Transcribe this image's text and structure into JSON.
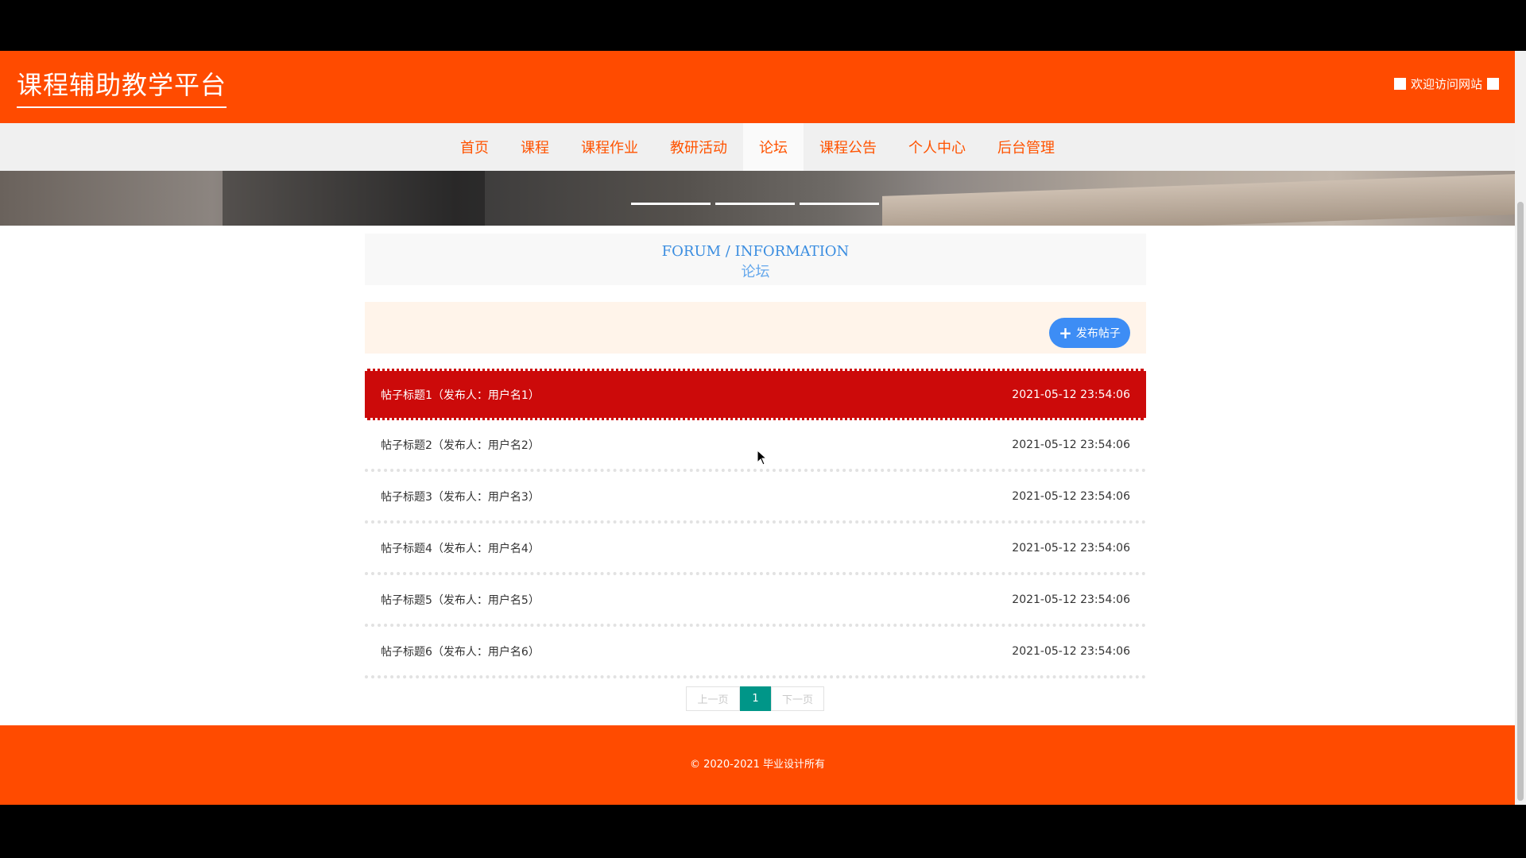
{
  "header": {
    "site_title": "课程辅助教学平台",
    "welcome_text": "欢迎访问网站",
    "brand_color": "#ff4b00"
  },
  "nav": {
    "items": [
      {
        "label": "首页"
      },
      {
        "label": "课程"
      },
      {
        "label": "课程作业"
      },
      {
        "label": "教研活动"
      },
      {
        "label": "论坛",
        "active": true
      },
      {
        "label": "课程公告"
      },
      {
        "label": "个人中心"
      },
      {
        "label": "后台管理"
      }
    ]
  },
  "banner": {
    "slide_count": 3
  },
  "section": {
    "title_en": "FORUM / INFORMATION",
    "title_cn": "论坛"
  },
  "actions": {
    "post_button_label": "发布帖子",
    "post_button_icon": "plus-icon"
  },
  "posts": [
    {
      "title": "帖子标题1（发布人：用户名1）",
      "time": "2021-05-12 23:54:06",
      "hovered": true
    },
    {
      "title": "帖子标题2（发布人：用户名2）",
      "time": "2021-05-12 23:54:06"
    },
    {
      "title": "帖子标题3（发布人：用户名3）",
      "time": "2021-05-12 23:54:06"
    },
    {
      "title": "帖子标题4（发布人：用户名4）",
      "time": "2021-05-12 23:54:06"
    },
    {
      "title": "帖子标题5（发布人：用户名5）",
      "time": "2021-05-12 23:54:06"
    },
    {
      "title": "帖子标题6（发布人：用户名6）",
      "time": "2021-05-12 23:54:06"
    }
  ],
  "pagination": {
    "prev_label": "上一页",
    "current_page": "1",
    "next_label": "下一页"
  },
  "footer": {
    "copyright": "© 2020-2021 毕业设计所有"
  }
}
